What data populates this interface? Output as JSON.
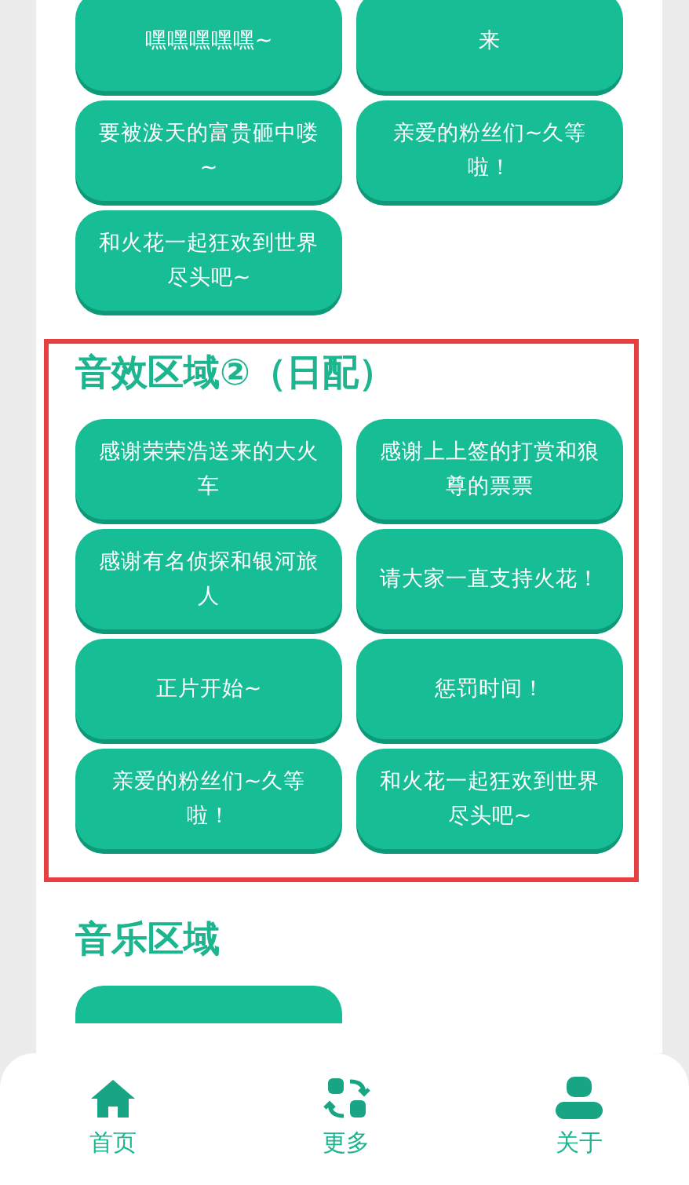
{
  "sections": [
    {
      "highlighted": false,
      "buttons": [
        "嘿嘿嘿嘿嘿~",
        "来",
        "要被泼天的富贵砸中喽~",
        "亲爱的粉丝们~久等啦！",
        "和火花一起狂欢到世界尽头吧~"
      ]
    },
    {
      "title": "音效区域②（日配）",
      "highlighted": true,
      "buttons": [
        "感谢荣荣浩送来的大火车",
        "感谢上上签的打赏和狼尊的票票",
        "感谢有名侦探和银河旅人",
        "请大家一直支持火花！",
        "正片开始~",
        "惩罚时间！",
        "亲爱的粉丝们~久等啦！",
        "和火花一起狂欢到世界尽头吧~"
      ]
    },
    {
      "title": "音乐区域",
      "highlighted": false,
      "cut_off": true
    }
  ],
  "nav": [
    {
      "kind": "home",
      "label": "首页"
    },
    {
      "kind": "more",
      "label": "更多"
    },
    {
      "kind": "about",
      "label": "关于"
    }
  ]
}
